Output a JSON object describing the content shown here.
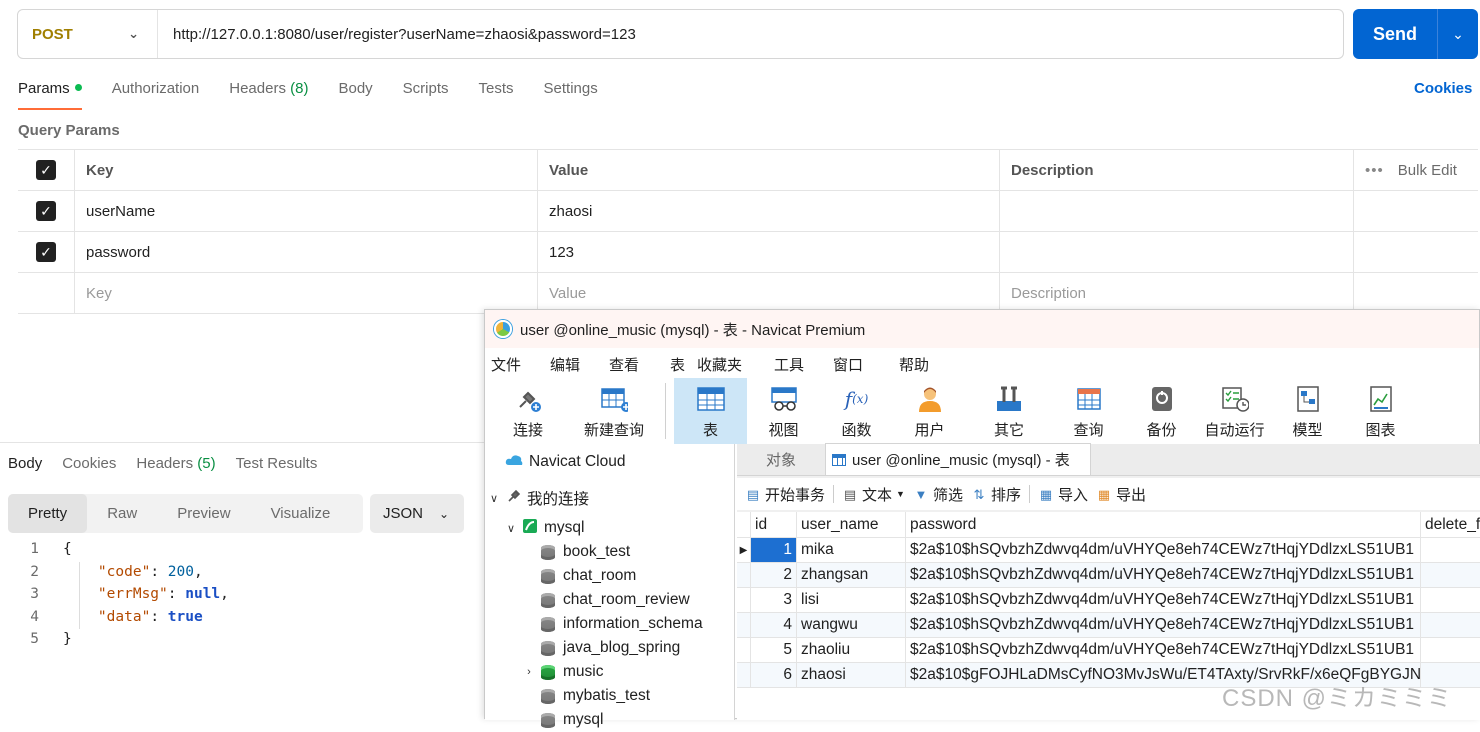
{
  "postman": {
    "method": "POST",
    "url": "http://127.0.0.1:8080/user/register?userName=zhaosi&password=123",
    "send_label": "Send",
    "tabs": [
      {
        "label": "Params"
      },
      {
        "label": "Authorization"
      },
      {
        "label": "Headers",
        "count": "(8)"
      },
      {
        "label": "Body"
      },
      {
        "label": "Scripts"
      },
      {
        "label": "Tests"
      },
      {
        "label": "Settings"
      }
    ],
    "cookies_label": "Cookies",
    "query_params_title": "Query Params",
    "params_headers": {
      "key": "Key",
      "value": "Value",
      "description": "Description",
      "bulk_edit": "Bulk Edit"
    },
    "params": [
      {
        "key": "userName",
        "value": "zhaosi",
        "checked": true
      },
      {
        "key": "password",
        "value": "123",
        "checked": true
      }
    ],
    "params_placeholder": {
      "key": "Key",
      "value": "Value",
      "description": "Description"
    },
    "response": {
      "tabs": [
        {
          "label": "Body"
        },
        {
          "label": "Cookies"
        },
        {
          "label": "Headers",
          "count": "(5)"
        },
        {
          "label": "Test Results"
        }
      ],
      "view_modes": [
        "Pretty",
        "Raw",
        "Preview",
        "Visualize"
      ],
      "format": "JSON",
      "code_lines": [
        {
          "num": "1",
          "text": "{"
        },
        {
          "num": "2",
          "key": "\"code\"",
          "val": "200",
          "trail": ","
        },
        {
          "num": "3",
          "key": "\"errMsg\"",
          "val": "null",
          "trail": ","
        },
        {
          "num": "4",
          "key": "\"data\"",
          "val": "true",
          "trail": ""
        },
        {
          "num": "5",
          "text": "}"
        }
      ]
    }
  },
  "navicat": {
    "title": "user @online_music (mysql) - 表 - Navicat Premium",
    "menu": [
      "文件",
      "编辑",
      "查看",
      "表",
      "收藏夹",
      "工具",
      "窗口",
      "帮助"
    ],
    "toolbar": [
      {
        "label": "连接",
        "icon": "plug-icon"
      },
      {
        "label": "新建查询",
        "icon": "new-query-icon"
      },
      {
        "label": "表",
        "icon": "table-icon"
      },
      {
        "label": "视图",
        "icon": "view-icon"
      },
      {
        "label": "函数",
        "icon": "function-icon"
      },
      {
        "label": "用户",
        "icon": "user-icon"
      },
      {
        "label": "其它",
        "icon": "tools-icon"
      },
      {
        "label": "查询",
        "icon": "query-icon"
      },
      {
        "label": "备份",
        "icon": "backup-icon"
      },
      {
        "label": "自动运行",
        "icon": "schedule-icon"
      },
      {
        "label": "模型",
        "icon": "model-icon"
      },
      {
        "label": "图表",
        "icon": "chart-icon"
      }
    ],
    "tree": {
      "cloud": "Navicat Cloud",
      "my_connections": "我的连接",
      "connection": "mysql",
      "databases": [
        "book_test",
        "chat_room",
        "chat_room_review",
        "information_schema",
        "java_blog_spring",
        "music",
        "mybatis_test",
        "mysql"
      ]
    },
    "tabs": {
      "objects": "对象",
      "active": "user @online_music (mysql) - 表"
    },
    "actions": [
      "开始事务",
      "文本",
      "筛选",
      "排序",
      "导入",
      "导出"
    ],
    "grid": {
      "columns": [
        "id",
        "user_name",
        "password",
        "delete_f"
      ],
      "rows": [
        {
          "id": "1",
          "user_name": "mika",
          "password": "$2a$10$hSQvbzhZdwvq4dm/uVHYQe8eh74CEWz7tHqjYDdlzxLS51UB1"
        },
        {
          "id": "2",
          "user_name": "zhangsan",
          "password": "$2a$10$hSQvbzhZdwvq4dm/uVHYQe8eh74CEWz7tHqjYDdlzxLS51UB1"
        },
        {
          "id": "3",
          "user_name": "lisi",
          "password": "$2a$10$hSQvbzhZdwvq4dm/uVHYQe8eh74CEWz7tHqjYDdlzxLS51UB1"
        },
        {
          "id": "4",
          "user_name": "wangwu",
          "password": "$2a$10$hSQvbzhZdwvq4dm/uVHYQe8eh74CEWz7tHqjYDdlzxLS51UB1"
        },
        {
          "id": "5",
          "user_name": "zhaoliu",
          "password": "$2a$10$hSQvbzhZdwvq4dm/uVHYQe8eh74CEWz7tHqjYDdlzxLS51UB1"
        },
        {
          "id": "6",
          "user_name": "zhaosi",
          "password": "$2a$10$gFOJHLaDMsCyfNO3MvJsWu/ET4TAxty/SrvRkF/x6eQFgBYGJN"
        }
      ]
    }
  },
  "watermark": "CSDN @ミカミミミ"
}
